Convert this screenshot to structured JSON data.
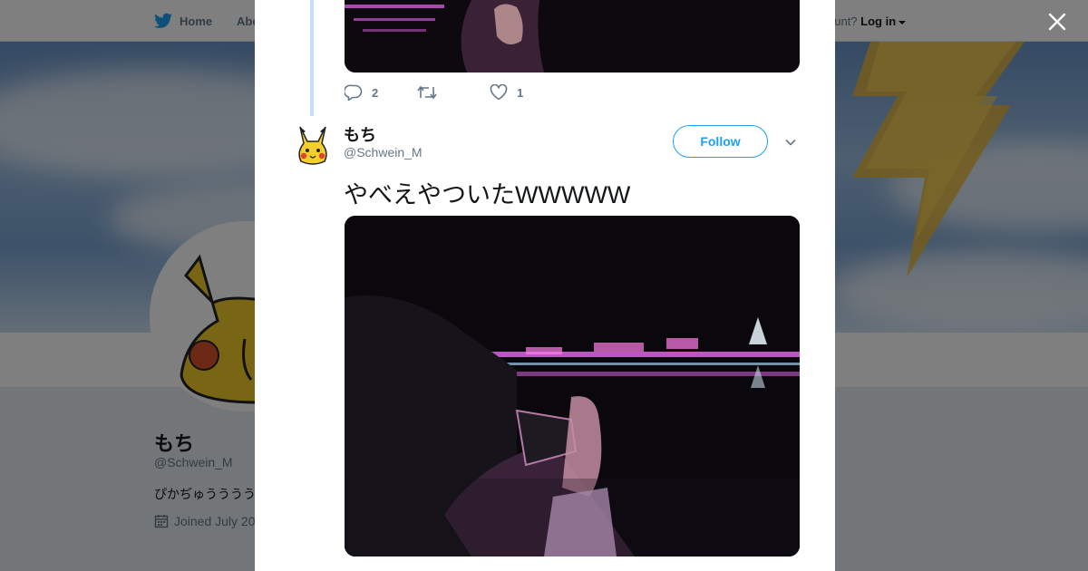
{
  "nav": {
    "home_label": "Home",
    "about_label": "Abo",
    "account_prompt": "ccount?",
    "login_label": "Log in"
  },
  "profile": {
    "name": "もち",
    "handle": "@Schwein_M",
    "bio": "ぴかぢゅううううう",
    "joined": "Joined July 20"
  },
  "previous_tweet": {
    "reply_count": "2",
    "retweet_count": "",
    "like_count": "1"
  },
  "tweet": {
    "author_name": "もち",
    "author_handle": "@Schwein_M",
    "follow_label": "Follow",
    "text": "やべえやついたWWWWW"
  },
  "colors": {
    "twitter_blue": "#1da1f2",
    "thread_line": "#c4def8",
    "text_primary": "#14171a",
    "text_secondary": "#657786"
  },
  "icons": {
    "close": "close-icon",
    "bird": "twitter-bird-icon",
    "reply": "reply-icon",
    "retweet": "retweet-icon",
    "like": "heart-icon",
    "chevron": "chevron-down-icon",
    "calendar": "calendar-icon"
  }
}
